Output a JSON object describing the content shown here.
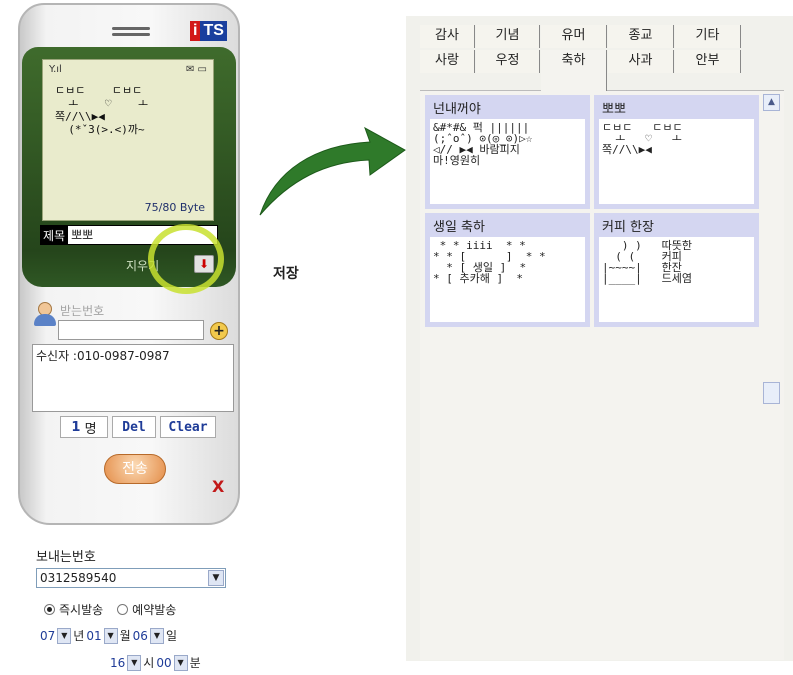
{
  "phone": {
    "brand": [
      "i",
      "TS"
    ],
    "status_left": "Y.ıl",
    "status_right": "✉ ▭",
    "screen_art": "ㄷㅂㄷ    ㄷㅂㄷ\n  ㅗ    ♡    ㅗ\n쪽//\\\\▶◀\n  (*ˇ3(>.<)까~",
    "byte_counter": "75/80 Byte",
    "subject_label": "제목",
    "subject_value": "뽀뽀",
    "clear_label": "지우기",
    "receiver_placeholder": "받는번호",
    "receiver_list": "수신자  :010-0987-0987",
    "count_value": "1",
    "count_unit": "명",
    "del_label": "Del",
    "clear_btn_label": "Clear",
    "send_label": "전송",
    "close_label": "X"
  },
  "sender": {
    "label": "보내는번호",
    "number": "0312589540",
    "radio_now": "즉시발송",
    "radio_reserve": "예약발송",
    "year": "07",
    "year_unit": "년",
    "month": "01",
    "month_unit": "월",
    "day": "06",
    "day_unit": "일",
    "hour": "16",
    "hour_unit": "시",
    "minute": "00",
    "minute_unit": "분"
  },
  "save_caption": "저장",
  "tabs_row1": [
    "감사",
    "기념",
    "유머",
    "종교",
    "기타"
  ],
  "tabs_row2": [
    "사랑",
    "우정",
    "축하",
    "사과",
    "안부"
  ],
  "active_tab": "축하",
  "cards": [
    {
      "title": "넌내꺼야",
      "body": "&#*#& 퍽 ||||||\n(;ˆoˆ) ⊙(◎_⊙)▷☆\n◁// ▶◀ 바람피지\n마!영원히"
    },
    {
      "title": "뽀뽀",
      "body": "ㄷㅂㄷ   ㄷㅂㄷ\n  ㅗ   ♡   ㅗ\n쪽//\\\\▶◀"
    },
    {
      "title": "생일 축하",
      "body": " * * iiii  * *\n* * [      ]  * *\n  * [ 생일 ]  *\n* [ 추카해 ]  *"
    },
    {
      "title": "커피 한장",
      "body": "   ) )   따뜻한\n  ( (    커피\n|~~~~|   한잔\n|____|   드세염"
    }
  ],
  "colors": {
    "accent_green": "#2f5824",
    "highlight": "#c8e12f",
    "card_header": "#d4d6f1"
  }
}
